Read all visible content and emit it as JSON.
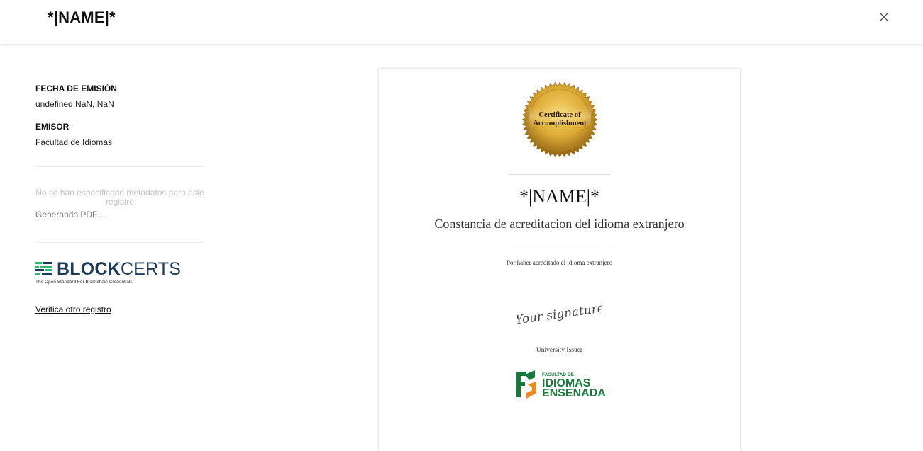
{
  "header": {
    "title": "*|NAME|*"
  },
  "sidebar": {
    "issue_date_label": "FECHA DE EMISIÓN",
    "issue_date_value": "undefined NaN, NaN",
    "issuer_label": "EMISOR",
    "issuer_value": "Facultad de Idiomas",
    "no_metadata": "No se han especificado metadatos para este registro",
    "generating_pdf": "Generando PDF...",
    "blockcerts_bold": "BLOCK",
    "blockcerts_light": "CERTS",
    "blockcerts_tagline": "The Open Standard For Blockchain Credentials",
    "verify_link": "Verifica otro registro"
  },
  "certificate": {
    "seal_line1": "Certificate of",
    "seal_line2": "Accomplishment",
    "name": "*|NAME|*",
    "subtitle": "Constancia de acreditacion del idioma extranjero",
    "description": "Por haber acreditado el idioma extranjero",
    "signature_text": "Your signature",
    "issuer": "University Issuer",
    "logo_small": "FACULTAD DE",
    "logo_line1": "IDIOMAS",
    "logo_line2": "ENSENADA"
  },
  "colors": {
    "seal_gold": "#d9a631",
    "blockcerts_navy": "#1c3a5a",
    "blockcerts_green": "#2bb673",
    "faculty_green": "#157a3a",
    "faculty_orange": "#f08a1c"
  }
}
